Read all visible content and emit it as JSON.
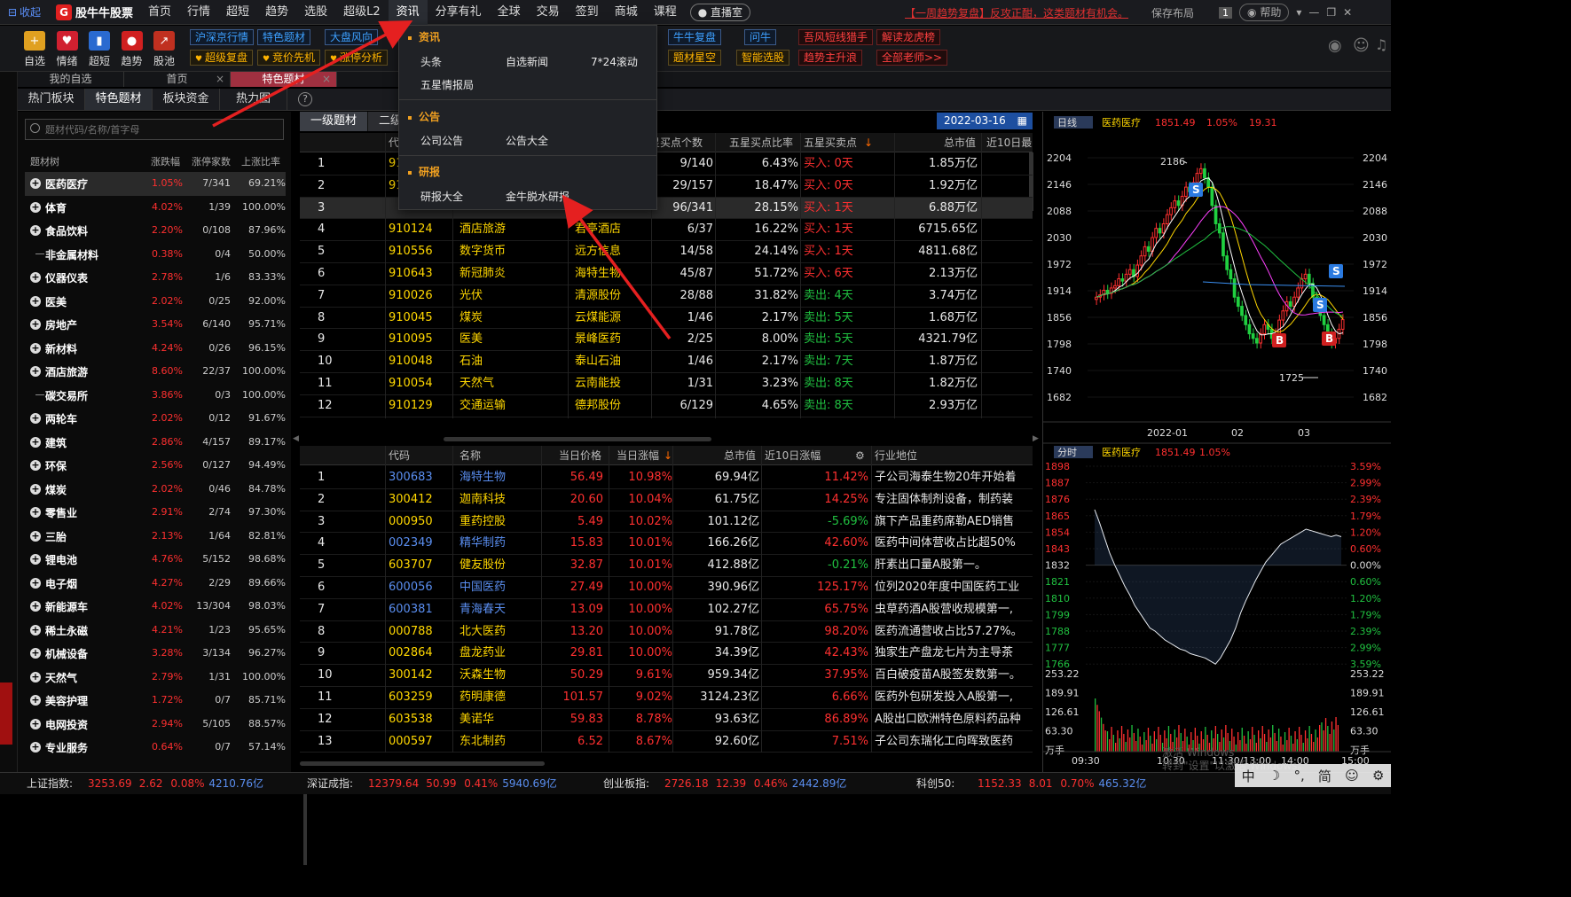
{
  "topbar": {
    "collapse": "收起",
    "logo": "股牛牛股票",
    "menu": [
      "首页",
      "行情",
      "超短",
      "趋势",
      "选股",
      "超级L2",
      "资讯",
      "分享有礼",
      "全球",
      "交易",
      "签到",
      "商城",
      "课程"
    ],
    "live": "直播室",
    "marquee": "【一周趋势复盘】反攻正酣，这类题材有机会。",
    "save_layout": "保存布局",
    "badge": "1",
    "help": "帮助"
  },
  "toolbar": {
    "tools": [
      {
        "label": "自选",
        "color": "#e0a020",
        "glyph": "+"
      },
      {
        "label": "情绪",
        "color": "#d02030",
        "glyph": "♥"
      },
      {
        "label": "超短",
        "color": "#2a6ad0",
        "glyph": "▮"
      },
      {
        "label": "趋势",
        "color": "#d02020",
        "glyph": "●"
      },
      {
        "label": "股池",
        "color": "#c03020",
        "glyph": "↗"
      }
    ],
    "row1": [
      {
        "t": "沪深京行情",
        "c": "b"
      },
      {
        "t": "特色题材",
        "c": "b"
      },
      {
        "t": "大盘风向",
        "c": "b"
      },
      {
        "t": "牛牛复盘",
        "c": "b"
      },
      {
        "t": "问牛",
        "c": "b"
      },
      {
        "t": "吾风短线猎手",
        "c": "r"
      },
      {
        "t": "解读龙虎榜",
        "c": "r"
      }
    ],
    "row2": [
      {
        "t": "超级复盘",
        "c": "y"
      },
      {
        "t": "竞价先机",
        "c": "y"
      },
      {
        "t": "涨停分析",
        "c": "y"
      },
      {
        "t": "题材星空",
        "c": "y"
      },
      {
        "t": "智能选股",
        "c": "y"
      },
      {
        "t": "趋势主升浪",
        "c": "r"
      },
      {
        "t": "全部老师>>",
        "c": "r"
      }
    ]
  },
  "tabs": [
    {
      "label": "我的自选"
    },
    {
      "label": "首页"
    },
    {
      "label": "特色题材"
    }
  ],
  "subtabs": [
    "热门板块",
    "特色题材",
    "板块资金",
    "热力图"
  ],
  "left": {
    "search_placeholder": "题材代码/名称/首字母",
    "headers": [
      "题材树",
      "涨跌幅",
      "涨停家数",
      "上涨比率"
    ],
    "rows": [
      {
        "name": "医药医疗",
        "chg": "1.05%",
        "lu": "7/341",
        "up": "69.21%",
        "plus": true
      },
      {
        "name": "体育",
        "chg": "4.02%",
        "lu": "1/39",
        "up": "100.00%",
        "plus": true
      },
      {
        "name": "食品饮料",
        "chg": "2.20%",
        "lu": "0/108",
        "up": "87.96%",
        "plus": true
      },
      {
        "name": "非金属材料",
        "chg": "0.38%",
        "lu": "0/4",
        "up": "50.00%",
        "plus": false
      },
      {
        "name": "仪器仪表",
        "chg": "2.78%",
        "lu": "1/6",
        "up": "83.33%",
        "plus": true
      },
      {
        "name": "医美",
        "chg": "2.02%",
        "lu": "0/25",
        "up": "92.00%",
        "plus": true
      },
      {
        "name": "房地产",
        "chg": "3.54%",
        "lu": "6/140",
        "up": "95.71%",
        "plus": true
      },
      {
        "name": "新材料",
        "chg": "4.24%",
        "lu": "0/26",
        "up": "96.15%",
        "plus": true
      },
      {
        "name": "酒店旅游",
        "chg": "8.60%",
        "lu": "22/37",
        "up": "100.00%",
        "plus": true
      },
      {
        "name": "碳交易所",
        "chg": "3.86%",
        "lu": "0/3",
        "up": "100.00%",
        "plus": false
      },
      {
        "name": "两轮车",
        "chg": "2.02%",
        "lu": "0/12",
        "up": "91.67%",
        "plus": true
      },
      {
        "name": "建筑",
        "chg": "2.86%",
        "lu": "4/157",
        "up": "89.17%",
        "plus": true
      },
      {
        "name": "环保",
        "chg": "2.56%",
        "lu": "0/127",
        "up": "94.49%",
        "plus": true
      },
      {
        "name": "煤炭",
        "chg": "2.02%",
        "lu": "0/46",
        "up": "84.78%",
        "plus": true
      },
      {
        "name": "零售业",
        "chg": "2.91%",
        "lu": "2/74",
        "up": "97.30%",
        "plus": true
      },
      {
        "name": "三胎",
        "chg": "2.13%",
        "lu": "1/64",
        "up": "82.81%",
        "plus": true
      },
      {
        "name": "锂电池",
        "chg": "4.76%",
        "lu": "5/152",
        "up": "98.68%",
        "plus": true
      },
      {
        "name": "电子烟",
        "chg": "4.27%",
        "lu": "2/29",
        "up": "89.66%",
        "plus": true
      },
      {
        "name": "新能源车",
        "chg": "4.02%",
        "lu": "13/304",
        "up": "98.03%",
        "plus": true
      },
      {
        "name": "稀土永磁",
        "chg": "4.21%",
        "lu": "1/23",
        "up": "95.65%",
        "plus": true
      },
      {
        "name": "机械设备",
        "chg": "3.28%",
        "lu": "3/134",
        "up": "96.27%",
        "plus": true
      },
      {
        "name": "天然气",
        "chg": "2.79%",
        "lu": "1/31",
        "up": "100.00%",
        "plus": true
      },
      {
        "name": "美容护理",
        "chg": "1.72%",
        "lu": "0/7",
        "up": "85.71%",
        "plus": true
      },
      {
        "name": "电网投资",
        "chg": "2.94%",
        "lu": "5/105",
        "up": "88.57%",
        "plus": true
      },
      {
        "name": "专业服务",
        "chg": "0.64%",
        "lu": "0/7",
        "up": "57.14%",
        "plus": true
      }
    ]
  },
  "mid": {
    "tabs": [
      "一级题材",
      "二级"
    ],
    "date": "2022-03-16",
    "top_headers": [
      "代码",
      "星买点个数",
      "五星买点比率",
      "五星买卖点",
      "总市值",
      "近10日最"
    ],
    "top_rows": [
      {
        "n": "1",
        "code": "91",
        "name": "",
        "lead": "",
        "cnt": "9/140",
        "ratio": "6.43%",
        "sig": "买入: 0天",
        "mv": "1.85万亿"
      },
      {
        "n": "2",
        "code": "91",
        "name": "",
        "lead": "",
        "cnt": "29/157",
        "ratio": "18.47%",
        "sig": "买入: 0天",
        "mv": "1.92万亿"
      },
      {
        "n": "3",
        "code": "",
        "name": "",
        "lead": "",
        "cnt": "96/341",
        "ratio": "28.15%",
        "sig": "买入: 1天",
        "mv": "6.88万亿"
      },
      {
        "n": "4",
        "code": "910124",
        "name": "酒店旅游",
        "lead": "君亭酒店",
        "cnt": "6/37",
        "ratio": "16.22%",
        "sig": "买入: 1天",
        "mv": "6715.65亿"
      },
      {
        "n": "5",
        "code": "910556",
        "name": "数字货币",
        "lead": "远方信息",
        "cnt": "14/58",
        "ratio": "24.14%",
        "sig": "买入: 1天",
        "mv": "4811.68亿"
      },
      {
        "n": "6",
        "code": "910643",
        "name": "新冠肺炎",
        "lead": "海特生物",
        "cnt": "45/87",
        "ratio": "51.72%",
        "sig": "买入: 6天",
        "mv": "2.13万亿"
      },
      {
        "n": "7",
        "code": "910026",
        "name": "光伏",
        "lead": "清源股份",
        "cnt": "28/88",
        "ratio": "31.82%",
        "sig": "卖出: 4天",
        "mv": "3.74万亿"
      },
      {
        "n": "8",
        "code": "910045",
        "name": "煤炭",
        "lead": "云煤能源",
        "cnt": "1/46",
        "ratio": "2.17%",
        "sig": "卖出: 5天",
        "mv": "1.68万亿"
      },
      {
        "n": "9",
        "code": "910095",
        "name": "医美",
        "lead": "景峰医药",
        "cnt": "2/25",
        "ratio": "8.00%",
        "sig": "卖出: 5天",
        "mv": "4321.79亿"
      },
      {
        "n": "10",
        "code": "910048",
        "name": "石油",
        "lead": "泰山石油",
        "cnt": "1/46",
        "ratio": "2.17%",
        "sig": "卖出: 7天",
        "mv": "1.87万亿"
      },
      {
        "n": "11",
        "code": "910054",
        "name": "天然气",
        "lead": "云南能投",
        "cnt": "1/31",
        "ratio": "3.23%",
        "sig": "卖出: 8天",
        "mv": "1.82万亿"
      },
      {
        "n": "12",
        "code": "910129",
        "name": "交通运输",
        "lead": "德邦股份",
        "cnt": "6/129",
        "ratio": "4.65%",
        "sig": "卖出: 8天",
        "mv": "2.93万亿"
      }
    ],
    "bot_headers": [
      "代码",
      "名称",
      "当日价格",
      "当日涨幅",
      "总市值",
      "近10日涨幅",
      "行业地位"
    ],
    "bot_rows": [
      {
        "n": "1",
        "code": "300683",
        "blue": true,
        "name": "海特生物",
        "price": "56.49",
        "chg": "10.98%",
        "mv": "69.94亿",
        "c10": "11.42%",
        "desc": "子公司海泰生物20年开始着"
      },
      {
        "n": "2",
        "code": "300412",
        "blue": false,
        "name": "迦南科技",
        "price": "20.60",
        "chg": "10.04%",
        "mv": "61.75亿",
        "c10": "14.25%",
        "desc": "专注固体制剂设备，制药装"
      },
      {
        "n": "3",
        "code": "000950",
        "blue": false,
        "name": "重药控股",
        "price": "5.49",
        "chg": "10.02%",
        "mv": "101.12亿",
        "c10": "-5.69%",
        "desc": "旗下产品重药席勒AED销售"
      },
      {
        "n": "4",
        "code": "002349",
        "blue": true,
        "name": "精华制药",
        "price": "15.83",
        "chg": "10.01%",
        "mv": "166.26亿",
        "c10": "42.60%",
        "desc": "医药中间体营收占比超50%"
      },
      {
        "n": "5",
        "code": "603707",
        "blue": false,
        "name": "健友股份",
        "price": "32.87",
        "chg": "10.01%",
        "mv": "412.88亿",
        "c10": "-0.21%",
        "desc": "肝素出口量A股第一。"
      },
      {
        "n": "6",
        "code": "600056",
        "blue": true,
        "name": "中国医药",
        "price": "27.49",
        "chg": "10.00%",
        "mv": "390.96亿",
        "c10": "125.17%",
        "desc": "位列2020年度中国医药工业"
      },
      {
        "n": "7",
        "code": "600381",
        "blue": true,
        "name": "青海春天",
        "price": "13.09",
        "chg": "10.00%",
        "mv": "102.27亿",
        "c10": "65.75%",
        "desc": "虫草药酒A股营收规模第一,"
      },
      {
        "n": "8",
        "code": "000788",
        "blue": false,
        "name": "北大医药",
        "price": "13.20",
        "chg": "10.00%",
        "mv": "91.78亿",
        "c10": "98.20%",
        "desc": "医药流通营收占比57.27%。"
      },
      {
        "n": "9",
        "code": "002864",
        "blue": false,
        "name": "盘龙药业",
        "price": "29.81",
        "chg": "10.00%",
        "mv": "34.39亿",
        "c10": "42.43%",
        "desc": "独家生产盘龙七片为主导茶"
      },
      {
        "n": "10",
        "code": "300142",
        "blue": false,
        "name": "沃森生物",
        "price": "50.29",
        "chg": "9.61%",
        "mv": "959.34亿",
        "c10": "37.95%",
        "desc": "百白破疫苗A股签发数第一。"
      },
      {
        "n": "11",
        "code": "603259",
        "blue": false,
        "name": "药明康德",
        "price": "101.57",
        "chg": "9.02%",
        "mv": "3124.23亿",
        "c10": "6.66%",
        "desc": "医药外包研发投入A股第一,"
      },
      {
        "n": "12",
        "code": "603538",
        "blue": false,
        "name": "美诺华",
        "price": "59.83",
        "chg": "8.78%",
        "mv": "93.63亿",
        "c10": "86.89%",
        "desc": "A股出口欧洲特色原料药品种"
      },
      {
        "n": "13",
        "code": "000597",
        "blue": false,
        "name": "东北制药",
        "price": "6.52",
        "chg": "8.67%",
        "mv": "92.60亿",
        "c10": "7.51%",
        "desc": "子公司东瑞化工向晖致医药"
      }
    ]
  },
  "dropdown": {
    "sections": [
      {
        "title": "资讯",
        "items": [
          "头条",
          "自选新闻",
          "7*24滚动",
          "五星情报局"
        ]
      },
      {
        "title": "公告",
        "items": [
          "公司公告",
          "公告大全"
        ]
      },
      {
        "title": "研报",
        "items": [
          "研报大全",
          "金牛脱水研报"
        ]
      }
    ]
  },
  "right": {
    "kline_label": "日线",
    "kline_name": "医药医疗",
    "kline_price": "1851.49",
    "kline_pct": "1.05%",
    "kline_chg": "19.31",
    "kline_yticks": [
      "2204",
      "2146",
      "2088",
      "2030",
      "1972",
      "1914",
      "1856",
      "1798",
      "1740",
      "1682"
    ],
    "kline_xticks": [
      "2022-01",
      "02",
      "03"
    ],
    "kline_high": "2186",
    "kline_low": "1725",
    "time_label": "分时",
    "time_name": "医药医疗",
    "time_price": "1851.49",
    "time_pct": "1.05%",
    "time_yleft": [
      "1898",
      "1887",
      "1876",
      "1865",
      "1854",
      "1843",
      "1832",
      "1821",
      "1810",
      "1799",
      "1788",
      "1777",
      "1766"
    ],
    "time_yright": [
      "3.59%",
      "2.99%",
      "2.39%",
      "1.79%",
      "1.20%",
      "0.60%",
      "0.00%",
      "0.60%",
      "1.20%",
      "1.79%",
      "2.39%",
      "2.99%",
      "3.59%"
    ],
    "vol_ticks": [
      "253.22",
      "189.91",
      "126.61",
      "63.30",
      "万手"
    ],
    "time_xticks": [
      "09:30",
      "10:30",
      "11:30/13:00",
      "14:00",
      "15:00"
    ],
    "markers": {
      "sell": "S",
      "buy": "B"
    }
  },
  "bottom": {
    "sh": {
      "name": "上证指数:",
      "v": "3253.69",
      "c": "2.62",
      "p": "0.08%",
      "amt": "4210.76亿"
    },
    "sz": {
      "name": "深证成指:",
      "v": "12379.64",
      "c": "50.99",
      "p": "0.41%",
      "amt": "5940.69亿"
    },
    "cy": {
      "name": "创业板指:",
      "v": "2726.18",
      "c": "12.39",
      "p": "0.46%",
      "amt": "2442.89亿"
    },
    "kc": {
      "name": "科创50:",
      "v": "1152.33",
      "c": "8.01",
      "p": "0.70%",
      "amt": "465.32亿"
    }
  },
  "watermark": {
    "line1": "激活 Windows",
    "line2": "转到\"设置\"以激活 Windows。"
  },
  "ime": [
    "中",
    "☽",
    "°,",
    "简",
    "☺",
    "⚙"
  ]
}
